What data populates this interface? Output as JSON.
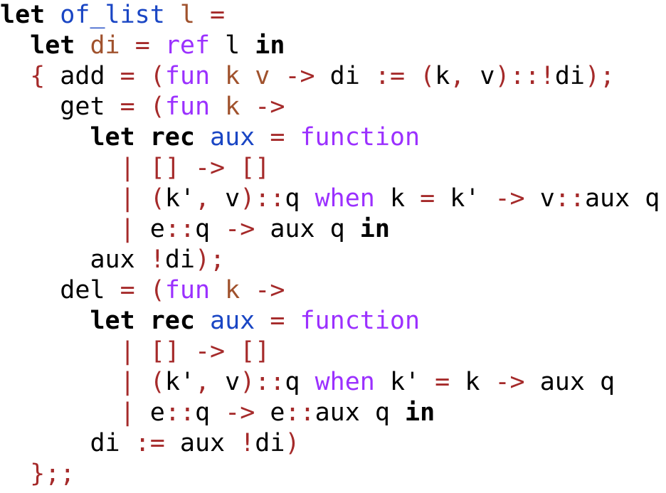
{
  "colors": {
    "plain": "#000000",
    "keyword": "#000000",
    "definition": "#1a46c4",
    "binding": "#a0522d",
    "operator": "#a52a2a",
    "builtin": "#9b30ff",
    "background": "#ffffff"
  },
  "lines": [
    {
      "indent": "",
      "tokens": [
        {
          "t": "let",
          "k": "keyword"
        },
        {
          "t": " ",
          "k": "plain"
        },
        {
          "t": "of_list",
          "k": "definition"
        },
        {
          "t": " ",
          "k": "plain"
        },
        {
          "t": "l",
          "k": "binding"
        },
        {
          "t": " ",
          "k": "plain"
        },
        {
          "t": "=",
          "k": "operator"
        }
      ]
    },
    {
      "indent": "  ",
      "tokens": [
        {
          "t": "let",
          "k": "keyword"
        },
        {
          "t": " ",
          "k": "plain"
        },
        {
          "t": "di",
          "k": "binding"
        },
        {
          "t": " ",
          "k": "plain"
        },
        {
          "t": "=",
          "k": "operator"
        },
        {
          "t": " ",
          "k": "plain"
        },
        {
          "t": "ref",
          "k": "builtin"
        },
        {
          "t": " l ",
          "k": "plain"
        },
        {
          "t": "in",
          "k": "keyword"
        }
      ]
    },
    {
      "indent": "  ",
      "tokens": [
        {
          "t": "{",
          "k": "operator"
        },
        {
          "t": " add ",
          "k": "plain"
        },
        {
          "t": "=",
          "k": "operator"
        },
        {
          "t": " ",
          "k": "plain"
        },
        {
          "t": "(",
          "k": "operator"
        },
        {
          "t": "fun",
          "k": "builtin"
        },
        {
          "t": " ",
          "k": "plain"
        },
        {
          "t": "k",
          "k": "binding"
        },
        {
          "t": " ",
          "k": "plain"
        },
        {
          "t": "v",
          "k": "binding"
        },
        {
          "t": " ",
          "k": "plain"
        },
        {
          "t": "->",
          "k": "operator"
        },
        {
          "t": " di ",
          "k": "plain"
        },
        {
          "t": ":=",
          "k": "operator"
        },
        {
          "t": " ",
          "k": "plain"
        },
        {
          "t": "(",
          "k": "operator"
        },
        {
          "t": "k",
          "k": "plain"
        },
        {
          "t": ",",
          "k": "operator"
        },
        {
          "t": " v",
          "k": "plain"
        },
        {
          "t": ")::!",
          "k": "operator"
        },
        {
          "t": "di",
          "k": "plain"
        },
        {
          "t": ");",
          "k": "operator"
        }
      ]
    },
    {
      "indent": "    ",
      "tokens": [
        {
          "t": "get ",
          "k": "plain"
        },
        {
          "t": "=",
          "k": "operator"
        },
        {
          "t": " ",
          "k": "plain"
        },
        {
          "t": "(",
          "k": "operator"
        },
        {
          "t": "fun",
          "k": "builtin"
        },
        {
          "t": " ",
          "k": "plain"
        },
        {
          "t": "k",
          "k": "binding"
        },
        {
          "t": " ",
          "k": "plain"
        },
        {
          "t": "->",
          "k": "operator"
        }
      ]
    },
    {
      "indent": "      ",
      "tokens": [
        {
          "t": "let",
          "k": "keyword"
        },
        {
          "t": " ",
          "k": "plain"
        },
        {
          "t": "rec",
          "k": "keyword"
        },
        {
          "t": " ",
          "k": "plain"
        },
        {
          "t": "aux",
          "k": "definition"
        },
        {
          "t": " ",
          "k": "plain"
        },
        {
          "t": "=",
          "k": "operator"
        },
        {
          "t": " ",
          "k": "plain"
        },
        {
          "t": "function",
          "k": "builtin"
        }
      ]
    },
    {
      "indent": "        ",
      "tokens": [
        {
          "t": "|",
          "k": "operator"
        },
        {
          "t": " ",
          "k": "plain"
        },
        {
          "t": "[]",
          "k": "operator"
        },
        {
          "t": " ",
          "k": "plain"
        },
        {
          "t": "->",
          "k": "operator"
        },
        {
          "t": " ",
          "k": "plain"
        },
        {
          "t": "[]",
          "k": "operator"
        }
      ]
    },
    {
      "indent": "        ",
      "tokens": [
        {
          "t": "|",
          "k": "operator"
        },
        {
          "t": " ",
          "k": "plain"
        },
        {
          "t": "(",
          "k": "operator"
        },
        {
          "t": "k'",
          "k": "plain"
        },
        {
          "t": ",",
          "k": "operator"
        },
        {
          "t": " v",
          "k": "plain"
        },
        {
          "t": ")::",
          "k": "operator"
        },
        {
          "t": "q ",
          "k": "plain"
        },
        {
          "t": "when",
          "k": "builtin"
        },
        {
          "t": " k ",
          "k": "plain"
        },
        {
          "t": "=",
          "k": "operator"
        },
        {
          "t": " k' ",
          "k": "plain"
        },
        {
          "t": "->",
          "k": "operator"
        },
        {
          "t": " v",
          "k": "plain"
        },
        {
          "t": "::",
          "k": "operator"
        },
        {
          "t": "aux q",
          "k": "plain"
        }
      ]
    },
    {
      "indent": "        ",
      "tokens": [
        {
          "t": "|",
          "k": "operator"
        },
        {
          "t": " e",
          "k": "plain"
        },
        {
          "t": "::",
          "k": "operator"
        },
        {
          "t": "q ",
          "k": "plain"
        },
        {
          "t": "->",
          "k": "operator"
        },
        {
          "t": " aux q ",
          "k": "plain"
        },
        {
          "t": "in",
          "k": "keyword"
        }
      ]
    },
    {
      "indent": "      ",
      "tokens": [
        {
          "t": "aux ",
          "k": "plain"
        },
        {
          "t": "!",
          "k": "operator"
        },
        {
          "t": "di",
          "k": "plain"
        },
        {
          "t": ");",
          "k": "operator"
        }
      ]
    },
    {
      "indent": "    ",
      "tokens": [
        {
          "t": "del ",
          "k": "plain"
        },
        {
          "t": "=",
          "k": "operator"
        },
        {
          "t": " ",
          "k": "plain"
        },
        {
          "t": "(",
          "k": "operator"
        },
        {
          "t": "fun",
          "k": "builtin"
        },
        {
          "t": " ",
          "k": "plain"
        },
        {
          "t": "k",
          "k": "binding"
        },
        {
          "t": " ",
          "k": "plain"
        },
        {
          "t": "->",
          "k": "operator"
        }
      ]
    },
    {
      "indent": "      ",
      "tokens": [
        {
          "t": "let",
          "k": "keyword"
        },
        {
          "t": " ",
          "k": "plain"
        },
        {
          "t": "rec",
          "k": "keyword"
        },
        {
          "t": " ",
          "k": "plain"
        },
        {
          "t": "aux",
          "k": "definition"
        },
        {
          "t": " ",
          "k": "plain"
        },
        {
          "t": "=",
          "k": "operator"
        },
        {
          "t": " ",
          "k": "plain"
        },
        {
          "t": "function",
          "k": "builtin"
        }
      ]
    },
    {
      "indent": "        ",
      "tokens": [
        {
          "t": "|",
          "k": "operator"
        },
        {
          "t": " ",
          "k": "plain"
        },
        {
          "t": "[]",
          "k": "operator"
        },
        {
          "t": " ",
          "k": "plain"
        },
        {
          "t": "->",
          "k": "operator"
        },
        {
          "t": " ",
          "k": "plain"
        },
        {
          "t": "[]",
          "k": "operator"
        }
      ]
    },
    {
      "indent": "        ",
      "tokens": [
        {
          "t": "|",
          "k": "operator"
        },
        {
          "t": " ",
          "k": "plain"
        },
        {
          "t": "(",
          "k": "operator"
        },
        {
          "t": "k'",
          "k": "plain"
        },
        {
          "t": ",",
          "k": "operator"
        },
        {
          "t": " v",
          "k": "plain"
        },
        {
          "t": ")::",
          "k": "operator"
        },
        {
          "t": "q ",
          "k": "plain"
        },
        {
          "t": "when",
          "k": "builtin"
        },
        {
          "t": " k' ",
          "k": "plain"
        },
        {
          "t": "=",
          "k": "operator"
        },
        {
          "t": " k ",
          "k": "plain"
        },
        {
          "t": "->",
          "k": "operator"
        },
        {
          "t": " aux q",
          "k": "plain"
        }
      ]
    },
    {
      "indent": "        ",
      "tokens": [
        {
          "t": "|",
          "k": "operator"
        },
        {
          "t": " e",
          "k": "plain"
        },
        {
          "t": "::",
          "k": "operator"
        },
        {
          "t": "q ",
          "k": "plain"
        },
        {
          "t": "->",
          "k": "operator"
        },
        {
          "t": " e",
          "k": "plain"
        },
        {
          "t": "::",
          "k": "operator"
        },
        {
          "t": "aux q ",
          "k": "plain"
        },
        {
          "t": "in",
          "k": "keyword"
        }
      ]
    },
    {
      "indent": "      ",
      "tokens": [
        {
          "t": "di ",
          "k": "plain"
        },
        {
          "t": ":=",
          "k": "operator"
        },
        {
          "t": " aux ",
          "k": "plain"
        },
        {
          "t": "!",
          "k": "operator"
        },
        {
          "t": "di",
          "k": "plain"
        },
        {
          "t": ")",
          "k": "operator"
        }
      ]
    },
    {
      "indent": "  ",
      "tokens": [
        {
          "t": "};;",
          "k": "operator"
        }
      ]
    }
  ]
}
